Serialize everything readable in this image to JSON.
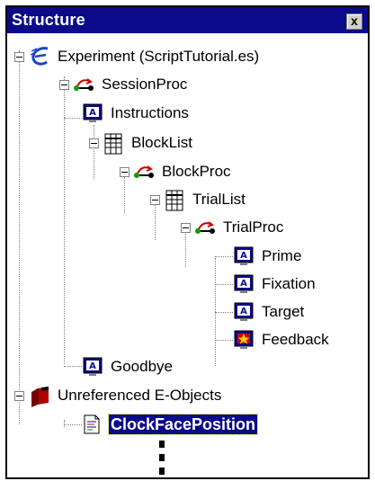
{
  "panel": {
    "title": "Structure",
    "close_label": "x"
  },
  "tree": {
    "experiment": "Experiment (ScriptTutorial.es)",
    "session_proc": "SessionProc",
    "instructions": "Instructions",
    "block_list": "BlockList",
    "block_proc": "BlockProc",
    "trial_list": "TrialList",
    "trial_proc": "TrialProc",
    "prime": "Prime",
    "fixation": "Fixation",
    "target": "Target",
    "feedback": "Feedback",
    "goodbye": "Goodbye",
    "unreferenced": "Unreferenced E-Objects",
    "clockface": "ClockFacePosition"
  },
  "colors": {
    "title_bg": "#0a0a8a",
    "selection_bg": "#0a0a8a"
  }
}
